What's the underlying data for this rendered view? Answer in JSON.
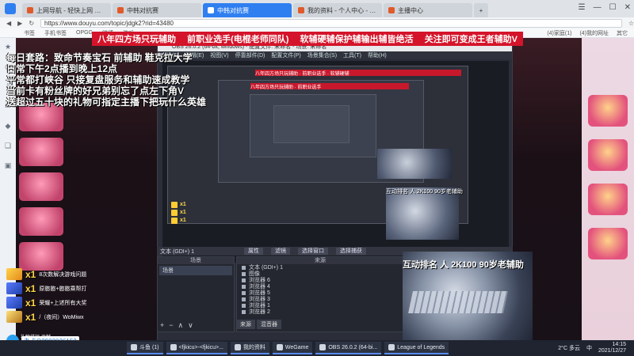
{
  "browser": {
    "tabs": [
      {
        "label": "上网导航 - 轻快上网 从这里开始",
        "active": false
      },
      {
        "label": "中韩对抗赛",
        "active": false
      },
      {
        "label": "中韩对抗赛",
        "active": true
      },
      {
        "label": "我的资料 - 个人中心 - 斗鱼",
        "active": false
      },
      {
        "label": "主播中心",
        "active": false
      }
    ],
    "new_tab": "+",
    "window_controls": [
      "☰",
      "—",
      "☐",
      "✕"
    ],
    "url": "https://www.douyu.com/topic/jdgk2?rid=43480",
    "bookmarks": [
      "书签",
      "手机书签",
      "OPGG",
      "微博",
      "游戏"
    ],
    "bookmarks_right": [
      "(4)家庭(1)",
      "(4)我的网址",
      "其它"
    ]
  },
  "stream": {
    "banner_items": [
      "八年四方场只玩辅助",
      "前职业选手(电棍老师同队)",
      "软辅硬辅保护辅输出辅皆绝活",
      "关注即可变成王者辅助V"
    ],
    "overlay_lines": [
      "每日套路：致命节奏宝石 前辅助 鞋克拉大学",
      "日常下午2点播到晚上12点",
      "平常都打峡谷 只接复盘服务和辅助速成教学",
      "当前卡有粉丝牌的好兄弟别忘了点左下角V",
      "送超过五十块的礼物可指定主播下把玩什么英雄"
    ],
    "camera_label": "互动排名 人 2K100 90岁老辅助",
    "camera_mini_label": "互动排名 人 2K100 90岁老辅助"
  },
  "obs": {
    "title": "OBS 26.0.2 (64-bit, windows) - 配置文件: 未命名 - 场景: 未命名",
    "menu": [
      "文件(F)",
      "编辑(E)",
      "视图(V)",
      "停靠部件(D)",
      "配置文件(P)",
      "场景集合(S)",
      "工具(T)",
      "帮助(H)"
    ],
    "scene_toolbar": [
      "属性",
      "滤镜",
      "选择窗口",
      "选择捕获"
    ],
    "scene_text": "文本 (GDI+) 1",
    "scenes_header": "场景",
    "scenes": [
      "场景"
    ],
    "sources_header": "来源",
    "sources": [
      "文本 (GDI+) 1",
      "图像",
      "浏览器 6",
      "浏览器 4",
      "浏览器 5",
      "浏览器 3",
      "浏览器 1",
      "浏览器 2"
    ],
    "dock_foot": [
      "+",
      "−",
      "∧",
      "∨"
    ],
    "source_tabs": [
      "来源",
      "混音器"
    ]
  },
  "gifts": [
    {
      "count": "x1",
      "text": "8次数解决游戏问题",
      "style": "a"
    },
    {
      "count": "x1",
      "text": "原憨憨+憨憨乘帮打",
      "style": "b"
    },
    {
      "count": "x1",
      "text": "荣耀+上述所有大奖",
      "style": "b"
    },
    {
      "count": "x1",
      "text": "/（夜间）WoMiwx",
      "style": "c"
    }
  ],
  "qq": {
    "label": "办卡Q2982036153",
    "top": "礼物排行·贡献"
  },
  "taskbar": {
    "items": [
      "斗鱼 (1)",
      "<fjkicu>-<fjkicu>...",
      "我的资料",
      "WeGame",
      "OBS 26.0.2 (64-bi...",
      "League of Legends"
    ],
    "tray": {
      "weather": "2°C 多云",
      "lang": "中",
      "time": "14:15",
      "date": "2021/12/27"
    }
  }
}
